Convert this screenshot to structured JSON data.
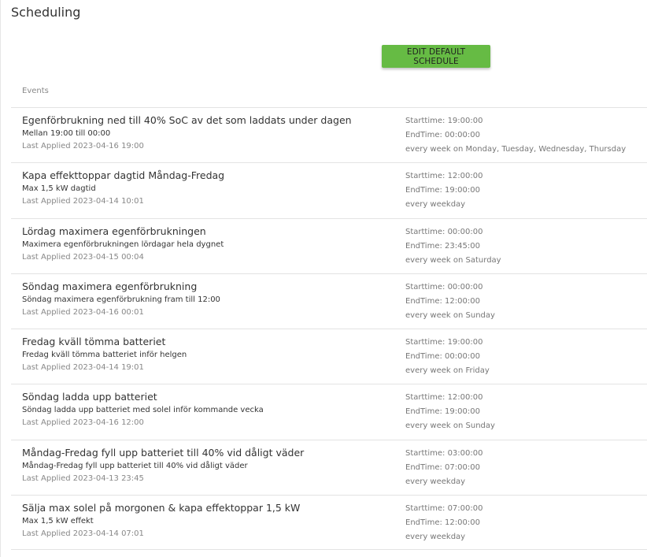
{
  "page": {
    "title": "Scheduling"
  },
  "toolbar": {
    "edit_default_label": "EDIT DEFAULT SCHEDULE"
  },
  "events": {
    "heading": "Events",
    "items": [
      {
        "title": "Egenförbrukning ned till 40% SoC av det som laddats under dagen",
        "description": "Mellan 19:00 till 00:00",
        "last_applied": "Last Applied 2023-04-16 19:00",
        "start": "Starttime: 19:00:00",
        "end": "EndTime: 00:00:00",
        "recurrence": "every week on Monday, Tuesday, Wednesday, Thursday"
      },
      {
        "title": "Kapa effekttoppar dagtid Måndag-Fredag",
        "description": "Max 1,5 kW dagtid",
        "last_applied": "Last Applied 2023-04-14 10:01",
        "start": "Starttime: 12:00:00",
        "end": "EndTime: 19:00:00",
        "recurrence": "every weekday"
      },
      {
        "title": "Lördag maximera egenförbrukningen",
        "description": "Maximera egenförbrukningen lördagar hela dygnet",
        "last_applied": "Last Applied 2023-04-15 00:04",
        "start": "Starttime: 00:00:00",
        "end": "EndTime: 23:45:00",
        "recurrence": "every week on Saturday"
      },
      {
        "title": "Söndag maximera egenförbrukning",
        "description": "Söndag maximera egenförbrukning fram till 12:00",
        "last_applied": "Last Applied 2023-04-16 00:01",
        "start": "Starttime: 00:00:00",
        "end": "EndTime: 12:00:00",
        "recurrence": "every week on Sunday"
      },
      {
        "title": "Fredag kväll tömma batteriet",
        "description": "Fredag kväll tömma batteriet inför helgen",
        "last_applied": "Last Applied 2023-04-14 19:01",
        "start": "Starttime: 19:00:00",
        "end": "EndTime: 00:00:00",
        "recurrence": "every week on Friday"
      },
      {
        "title": "Söndag ladda upp batteriet",
        "description": "Söndag ladda upp batteriet med solel inför kommande vecka",
        "last_applied": "Last Applied 2023-04-16 12:00",
        "start": "Starttime: 12:00:00",
        "end": "EndTime: 19:00:00",
        "recurrence": "every week on Sunday"
      },
      {
        "title": "Måndag-Fredag fyll upp batteriet till 40% vid dåligt väder",
        "description": "Måndag-Fredag fyll upp batteriet till 40% vid dåligt väder",
        "last_applied": "Last Applied 2023-04-13 23:45",
        "start": "Starttime: 03:00:00",
        "end": "EndTime: 07:00:00",
        "recurrence": "every weekday"
      },
      {
        "title": "Sälja max solel på morgonen & kapa effektoppar 1,5 kW",
        "description": "Max 1,5 kW effekt",
        "last_applied": "Last Applied 2023-04-14 07:01",
        "start": "Starttime: 07:00:00",
        "end": "EndTime: 12:00:00",
        "recurrence": "every weekday"
      }
    ]
  }
}
